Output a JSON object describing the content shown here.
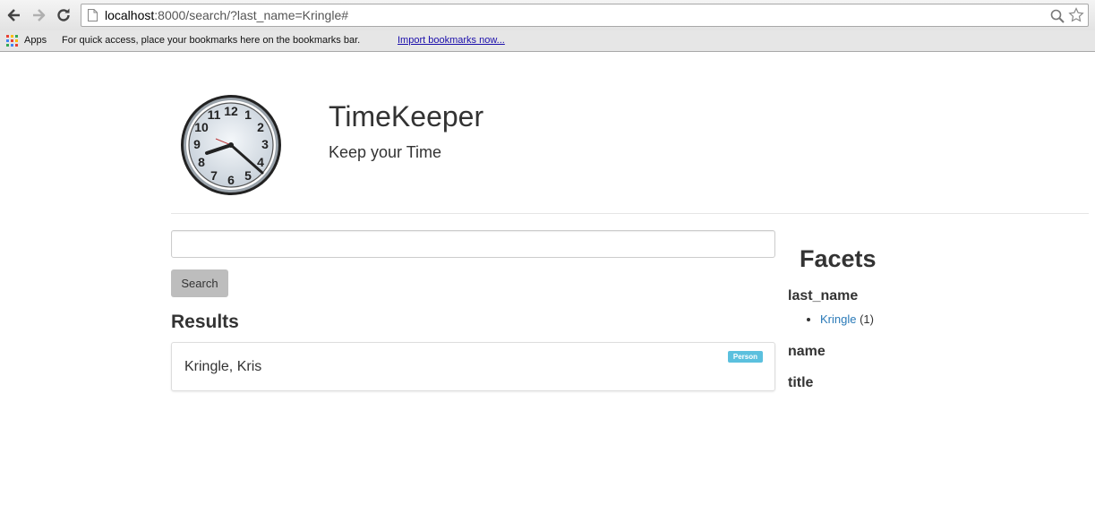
{
  "browser": {
    "url_host": "localhost",
    "url_path": ":8000/search/?last_name=Kringle#",
    "apps_label": "Apps",
    "bookmarks_hint": "For quick access, place your bookmarks here on the bookmarks bar.",
    "import_link": "Import bookmarks now..."
  },
  "site": {
    "title": "TimeKeeper",
    "subtitle": "Keep your Time"
  },
  "search": {
    "query": "",
    "button_label": "Search"
  },
  "results": {
    "heading": "Results",
    "items": [
      {
        "name": "Kringle, Kris",
        "type_badge": "Person"
      }
    ]
  },
  "facets": {
    "heading": "Facets",
    "groups": [
      {
        "title": "last_name",
        "values": [
          {
            "label": "Kringle",
            "count": "(1)"
          }
        ]
      },
      {
        "title": "name",
        "values": []
      },
      {
        "title": "title",
        "values": []
      }
    ]
  },
  "colors": {
    "badge": "#5bc0de",
    "link": "#2a7ab8",
    "button": "#bdbdbd"
  }
}
